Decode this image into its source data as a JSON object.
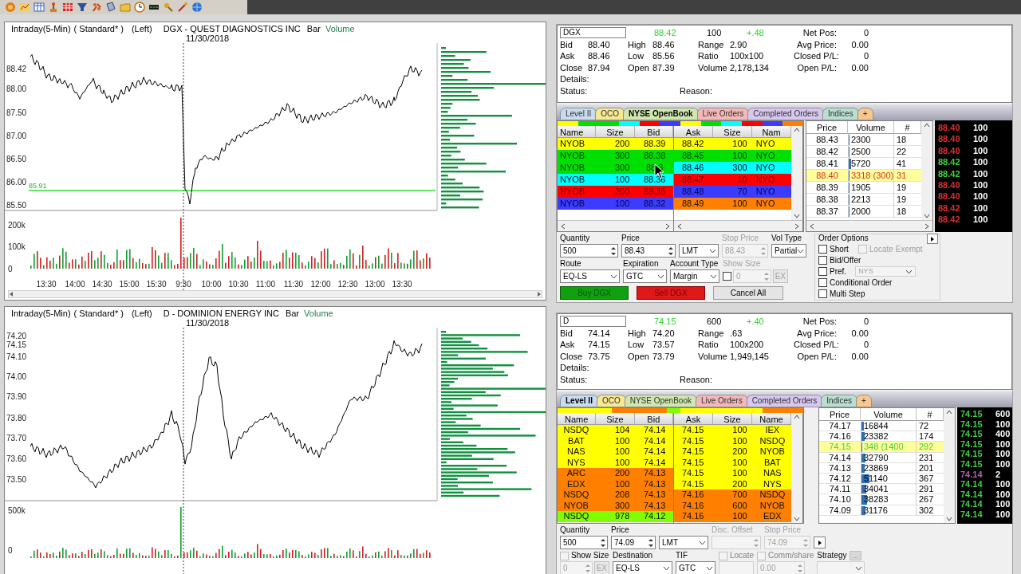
{
  "charts": [
    {
      "interval": "Intraday(5-Min)",
      "style": "( Standard* )",
      "side": "(Left)",
      "title": "DGX - QUEST DIAGNOSTICS INC",
      "chart_type": "Bar",
      "study": "Volume",
      "date": "11/30/2018",
      "price_labels": [
        "88.42",
        "88.00",
        "87.50",
        "87.00",
        "86.50",
        "86.00",
        "85.50"
      ],
      "marker": {
        "label": "85.91"
      },
      "volume_labels": [
        "200k",
        "100k",
        "0"
      ],
      "time_labels": [
        "13:30",
        "14:00",
        "14:30",
        "15:00",
        "15:30",
        "9:30",
        "10:00",
        "10:30",
        "11:00",
        "11:30",
        "12:00",
        "12:30",
        "13:00",
        "13:30"
      ]
    },
    {
      "interval": "Intraday(5-Min)",
      "style": "( Standard* )",
      "side": "(Left)",
      "title": "D - DOMINION ENERGY INC",
      "chart_type": "Bar",
      "study": "Volume",
      "date": "11/30/2018",
      "price_labels": [
        "74.20",
        "74.15",
        "74.10",
        "74.00",
        "73.90",
        "73.80",
        "73.70",
        "73.60",
        "73.50"
      ],
      "volume_labels": [
        "500k",
        "0"
      ]
    }
  ],
  "panels": [
    {
      "quote": {
        "symbol": "DGX",
        "last": "88.42",
        "last_size": "100",
        "change": "+.48",
        "stats": [
          {
            "label": "Bid",
            "value": "88.40"
          },
          {
            "label": "High",
            "value": "88.46"
          },
          {
            "label": "Range",
            "value": "2.90"
          },
          {
            "label": "Ask",
            "value": "88.46"
          },
          {
            "label": "Low",
            "value": "85.56"
          },
          {
            "label": "Ratio",
            "value": "100x100"
          },
          {
            "label": "Close",
            "value": "87.94"
          },
          {
            "label": "Open",
            "value": "87.39"
          },
          {
            "label": "Volume",
            "value": "2,178,134"
          }
        ],
        "position": [
          {
            "label": "Net Pos:",
            "value": "0"
          },
          {
            "label": "Avg Price:",
            "value": "0.00"
          },
          {
            "label": "Closed P/L:",
            "value": "0"
          },
          {
            "label": "Open P/L:",
            "value": "0.00"
          }
        ],
        "details_label": "Details:",
        "status_label": "Status:",
        "reason_label": "Reason:"
      },
      "tabs": [
        {
          "label": "Level II",
          "color": "#c8dcf0",
          "selected": false
        },
        {
          "label": "OCO",
          "color": "#f8e890",
          "selected": false
        },
        {
          "label": "NYSE OpenBook",
          "color": "#d0e8b0",
          "selected": true
        },
        {
          "label": "Live Orders",
          "color": "#f4b8b8",
          "selected": false
        },
        {
          "label": "Completed Orders",
          "color": "#d8c8f0",
          "selected": false
        },
        {
          "label": "Indices",
          "color": "#b8e0d0",
          "selected": false
        },
        {
          "label": "+",
          "color": "#f8c890",
          "selected": false
        }
      ],
      "bid_columns": [
        "Name",
        "Size",
        "Bid"
      ],
      "ask_columns": [
        "Ask",
        "Size",
        "Nam"
      ],
      "bids": [
        {
          "name": "NYOB",
          "size": "200",
          "price": "88.39",
          "color": "#ffff00"
        },
        {
          "name": "NYOB",
          "size": "300",
          "price": "88.38",
          "color": "#00e000"
        },
        {
          "name": "NYOB",
          "size": "300",
          "price": "88.3",
          "color": "#00e000"
        },
        {
          "name": "NYOB",
          "size": "100",
          "price": "88.36",
          "color": "#00ffff"
        },
        {
          "name": "NYOB",
          "size": "200",
          "price": "88.35",
          "color": "#ff0000"
        },
        {
          "name": "NYOB",
          "size": "100",
          "price": "88.32",
          "color": "#3c3cff"
        }
      ],
      "asks": [
        {
          "price": "88.42",
          "size": "100",
          "name": "NYO",
          "color": "#ffff00"
        },
        {
          "price": "88.45",
          "size": "100",
          "name": "NYO",
          "color": "#00e000"
        },
        {
          "price": "88.46",
          "size": "300",
          "name": "NYO",
          "color": "#00ffff"
        },
        {
          "price": "88.47",
          "size": "10",
          "name": "NYO",
          "color": "#ff0000"
        },
        {
          "price": "88.48",
          "size": "70",
          "name": "NYO",
          "color": "#3c3cff"
        },
        {
          "price": "88.49",
          "size": "100",
          "name": "NYO",
          "color": "#ff8000"
        }
      ],
      "ladder_columns": [
        "Price",
        "Volume",
        "#"
      ],
      "ladder": [
        {
          "price": "88.43",
          "volume": "2300",
          "count": "18",
          "level": 0.01,
          "highlighted": false
        },
        {
          "price": "88.42",
          "volume": "2500",
          "count": "22",
          "level": 0.01,
          "highlighted": false
        },
        {
          "price": "88.41",
          "volume": "5720",
          "count": "41",
          "level": 0.05,
          "highlighted": false
        },
        {
          "price": "88.40",
          "volume": "3318 (300)",
          "count": "31",
          "level": 0.01,
          "highlighted": true
        },
        {
          "price": "88.39",
          "volume": "1905",
          "count": "19",
          "level": 0.01,
          "highlighted": false
        },
        {
          "price": "88.38",
          "volume": "2213",
          "count": "19",
          "level": 0.01,
          "highlighted": false
        },
        {
          "price": "88.37",
          "volume": "2000",
          "count": "18",
          "level": 0.01,
          "highlighted": false
        }
      ],
      "trades": [
        {
          "price": "88.40",
          "size": "100",
          "color": "#d83030"
        },
        {
          "price": "88.40",
          "size": "100",
          "color": "#d83030"
        },
        {
          "price": "88.40",
          "size": "100",
          "color": "#d83030"
        },
        {
          "price": "88.42",
          "size": "100",
          "color": "#40d040"
        },
        {
          "price": "88.42",
          "size": "100",
          "color": "#40d040"
        },
        {
          "price": "88.40",
          "size": "100",
          "color": "#d83030"
        },
        {
          "price": "88.40",
          "size": "100",
          "color": "#d83030"
        },
        {
          "price": "88.42",
          "size": "100",
          "color": "#d83030"
        },
        {
          "price": "88.42",
          "size": "100",
          "color": "#d83030"
        }
      ],
      "form": {
        "rows": [
          [
            {
              "label": "Quantity",
              "kind": "spin",
              "value": "500",
              "disabled": false
            },
            {
              "label": "Price",
              "kind": "spin",
              "value": "88.43",
              "disabled": false
            },
            {
              "kind": "select",
              "value": "LMT",
              "disabled": false
            },
            {
              "label": "Stop Price",
              "kind": "spin",
              "value": "88.43",
              "disabled": true
            },
            {
              "label": "Vol Type",
              "kind": "select",
              "value": "Partial",
              "disabled": false
            }
          ],
          [
            {
              "label": "Route",
              "kind": "select",
              "value": "EQ-LS",
              "disabled": false
            },
            {
              "label": "Expiration",
              "kind": "select",
              "value": "GTC",
              "disabled": false
            },
            {
              "label": "Account Type",
              "kind": "select",
              "value": "Margin",
              "disabled": false
            },
            {
              "label": "Show Size",
              "kind": "check-spin",
              "checked": false,
              "value": "0",
              "button": "EX",
              "disabled": true
            }
          ]
        ],
        "buttons": [
          {
            "label": "Buy DGX",
            "kind": "buy"
          },
          {
            "label": "Sell DGX",
            "kind": "sell"
          },
          {
            "label": "Cancel All",
            "kind": "plain"
          }
        ],
        "options": {
          "title": "Order Options",
          "rows": [
            [
              {
                "label": "Short",
                "checked": false,
                "disabled": false
              },
              {
                "label": "Locate Exempt",
                "checked": false,
                "disabled": true
              }
            ],
            [
              {
                "label": "Bid/Offer",
                "checked": false,
                "disabled": false
              }
            ],
            [
              {
                "label": "Pref.",
                "checked": false,
                "disabled": false,
                "select": "NYS"
              }
            ],
            [
              {
                "label": "Conditional Order",
                "checked": false,
                "disabled": false
              }
            ],
            [
              {
                "label": "Multi Step",
                "checked": false,
                "disabled": false
              }
            ]
          ]
        },
        "more_button": true
      },
      "cursor": true
    },
    {
      "quote": {
        "symbol": "D",
        "last": "74.15",
        "last_size": "600",
        "change": "+.40",
        "stats": [
          {
            "label": "Bid",
            "value": "74.14"
          },
          {
            "label": "High",
            "value": "74.20"
          },
          {
            "label": "Range",
            "value": ".63"
          },
          {
            "label": "Ask",
            "value": "74.15"
          },
          {
            "label": "Low",
            "value": "73.57"
          },
          {
            "label": "Ratio",
            "value": "100x200"
          },
          {
            "label": "Close",
            "value": "73.75"
          },
          {
            "label": "Open",
            "value": "73.79"
          },
          {
            "label": "Volume",
            "value": "1,949,145"
          }
        ],
        "position": [
          {
            "label": "Net Pos:",
            "value": "0"
          },
          {
            "label": "Avg Price:",
            "value": "0.00"
          },
          {
            "label": "Closed P/L:",
            "value": "0"
          },
          {
            "label": "Open P/L:",
            "value": "0.00"
          }
        ],
        "details_label": "Details:",
        "status_label": "Status:",
        "reason_label": "Reason:"
      },
      "tabs": [
        {
          "label": "Level II",
          "color": "#c8dcf0",
          "selected": true
        },
        {
          "label": "OCO",
          "color": "#f8e890",
          "selected": false
        },
        {
          "label": "NYSE OpenBook",
          "color": "#d0e8b0",
          "selected": false
        },
        {
          "label": "Live Orders",
          "color": "#f4b8b8",
          "selected": false
        },
        {
          "label": "Completed Orders",
          "color": "#d8c8f0",
          "selected": false
        },
        {
          "label": "Indices",
          "color": "#b8e0d0",
          "selected": false
        },
        {
          "label": "+",
          "color": "#f8c890",
          "selected": false
        }
      ],
      "bid_columns": [
        "Name",
        "Size",
        "Bid"
      ],
      "ask_columns": [
        "Ask",
        "Size",
        "Name"
      ],
      "bids": [
        {
          "name": "NSDQ",
          "size": "104",
          "price": "74.14",
          "color": "#ffff00"
        },
        {
          "name": "BAT",
          "size": "100",
          "price": "74.14",
          "color": "#ffff00"
        },
        {
          "name": "NAS",
          "size": "100",
          "price": "74.14",
          "color": "#ffff00"
        },
        {
          "name": "NYS",
          "size": "100",
          "price": "74.14",
          "color": "#ffff00"
        },
        {
          "name": "ARC",
          "size": "200",
          "price": "74.13",
          "color": "#ff8000"
        },
        {
          "name": "EDX",
          "size": "100",
          "price": "74.13",
          "color": "#ff8000"
        },
        {
          "name": "NSDQ",
          "size": "208",
          "price": "74.13",
          "color": "#ff8000"
        },
        {
          "name": "NYOB",
          "size": "300",
          "price": "74.13",
          "color": "#ff8000"
        },
        {
          "name": "NSDQ",
          "size": "978",
          "price": "74.12",
          "color": "#80ff00"
        }
      ],
      "asks": [
        {
          "price": "74.15",
          "size": "100",
          "name": "IEX",
          "color": "#ffff00"
        },
        {
          "price": "74.15",
          "size": "100",
          "name": "NSDQ",
          "color": "#ffff00"
        },
        {
          "price": "74.15",
          "size": "200",
          "name": "NYOB",
          "color": "#ffff00"
        },
        {
          "price": "74.15",
          "size": "100",
          "name": "BAT",
          "color": "#ffff00"
        },
        {
          "price": "74.15",
          "size": "100",
          "name": "NAS",
          "color": "#ffff00"
        },
        {
          "price": "74.15",
          "size": "200",
          "name": "NYS",
          "color": "#ffff00"
        },
        {
          "price": "74.16",
          "size": "700",
          "name": "NSDQ",
          "color": "#ff8000"
        },
        {
          "price": "74.16",
          "size": "600",
          "name": "NYOB",
          "color": "#ff8000"
        },
        {
          "price": "74.16",
          "size": "100",
          "name": "EDX",
          "color": "#ff8000"
        }
      ],
      "ladder_columns": [
        "Price",
        "Volume",
        "#"
      ],
      "ladder": [
        {
          "price": "74.17",
          "volume": "16844",
          "count": "72",
          "level": 0.04,
          "highlighted": false
        },
        {
          "price": "74.16",
          "volume": "23382",
          "count": "174",
          "level": 0.06,
          "highlighted": false
        },
        {
          "price": "74.15",
          "volume": "348 (1400",
          "count": "292",
          "level": 0.02,
          "highlighted": true
        },
        {
          "price": "74.14",
          "volume": "32790",
          "count": "231",
          "level": 0.08,
          "highlighted": false
        },
        {
          "price": "74.13",
          "volume": "23869",
          "count": "201",
          "level": 0.06,
          "highlighted": false
        },
        {
          "price": "74.12",
          "volume": "51140",
          "count": "367",
          "level": 0.14,
          "highlighted": false
        },
        {
          "price": "74.11",
          "volume": "34041",
          "count": "291",
          "level": 0.09,
          "highlighted": false
        },
        {
          "price": "74.10",
          "volume": "38283",
          "count": "267",
          "level": 0.1,
          "highlighted": false
        },
        {
          "price": "74.09",
          "volume": "31176",
          "count": "302",
          "level": 0.08,
          "highlighted": false
        }
      ],
      "trades": [
        {
          "price": "74.15",
          "size": "600",
          "color": "#40d040"
        },
        {
          "price": "74.15",
          "size": "100",
          "color": "#40d040"
        },
        {
          "price": "74.15",
          "size": "400",
          "color": "#40d040"
        },
        {
          "price": "74.15",
          "size": "100",
          "color": "#40d040"
        },
        {
          "price": "74.15",
          "size": "100",
          "color": "#40d040"
        },
        {
          "price": "74.15",
          "size": "100",
          "color": "#40d040"
        },
        {
          "price": "74.14",
          "size": "2",
          "color": "#b060b0"
        },
        {
          "price": "74.14",
          "size": "100",
          "color": "#40d040"
        },
        {
          "price": "74.14",
          "size": "100",
          "color": "#40d040"
        },
        {
          "price": "74.14",
          "size": "100",
          "color": "#40d040"
        },
        {
          "price": "74.14",
          "size": "100",
          "color": "#40d040"
        }
      ],
      "form": {
        "rows": [
          [
            {
              "label": "Quantity",
              "kind": "spin",
              "value": "500",
              "disabled": false
            },
            {
              "label": "Price",
              "kind": "spin",
              "value": "74.09",
              "disabled": false
            },
            {
              "kind": "select",
              "value": "LMT",
              "disabled": false
            },
            {
              "label": "Disc. Offset",
              "kind": "spin",
              "disabled": true
            },
            {
              "label": "Stop Price",
              "kind": "spin",
              "value": "74.09",
              "disabled": true
            },
            {
              "kind": "arrow"
            }
          ],
          [
            {
              "label": "Show Size",
              "label_check": false,
              "kind": "ex-spin",
              "value": "0",
              "button": "EX",
              "disabled": true
            },
            {
              "label": "Destination",
              "kind": "select",
              "value": "EQ-LS",
              "disabled": false
            },
            {
              "label": "TIF",
              "kind": "select",
              "value": "GTC",
              "disabled": false
            },
            {
              "label": "Locate",
              "label_check": false,
              "kind": "text",
              "disabled": true
            },
            {
              "label": "Comm/share",
              "label_check": false,
              "kind": "spin",
              "value": "0.00",
              "disabled": true
            },
            {
              "label": "Strategy",
              "label_button": "...",
              "kind": "select",
              "disabled": true
            }
          ]
        ]
      },
      "cursor": false
    }
  ]
}
